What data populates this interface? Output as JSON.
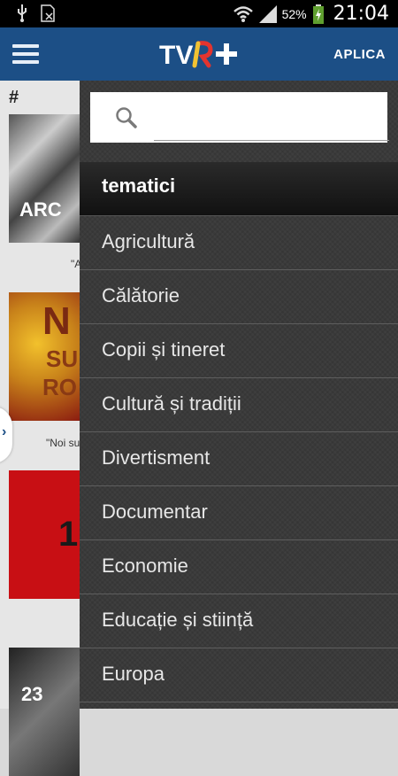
{
  "status_bar": {
    "battery": "52%",
    "time": "21:04",
    "icons": [
      "usb-icon",
      "sim-icon",
      "wifi-icon",
      "signal-icon",
      "battery-icon"
    ]
  },
  "app_bar": {
    "logo": "TVR+",
    "action": "APLICA"
  },
  "background_list": {
    "header": "#",
    "captions": [
      "\"A",
      "\"Noi su"
    ],
    "thumb_texts": [
      "ARC",
      "N",
      "SU",
      "RO",
      "1",
      "23"
    ]
  },
  "drawer": {
    "search_placeholder": "",
    "section_title": "tematici",
    "items": [
      "Agricultură",
      "Călătorie",
      "Copii și tineret",
      "Cultură și tradiții",
      "Divertisment",
      "Documentar",
      "Economie",
      "Educație și stiință",
      "Europa"
    ]
  },
  "colors": {
    "app_bar": "#1c4f86",
    "drawer": "#3a3a3a",
    "logo_accent": "#e3342f"
  }
}
